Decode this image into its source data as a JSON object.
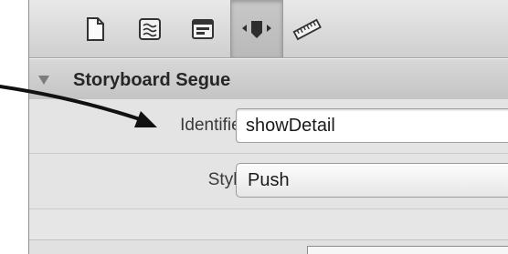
{
  "toolbar": {
    "tools": [
      {
        "icon": "file-icon",
        "selected": false
      },
      {
        "icon": "quick-help-icon",
        "selected": false
      },
      {
        "icon": "identity-icon",
        "selected": false
      },
      {
        "icon": "attributes-icon",
        "selected": true
      },
      {
        "icon": "size-icon",
        "selected": false
      }
    ]
  },
  "section": {
    "title": "Storyboard Segue"
  },
  "fields": {
    "identifier_label": "Identifier",
    "identifier_value": "showDetail",
    "style_label": "Style",
    "style_value": "Push"
  },
  "colors": {
    "panel_background": "#e6e6e6",
    "arrow": "#111111"
  }
}
